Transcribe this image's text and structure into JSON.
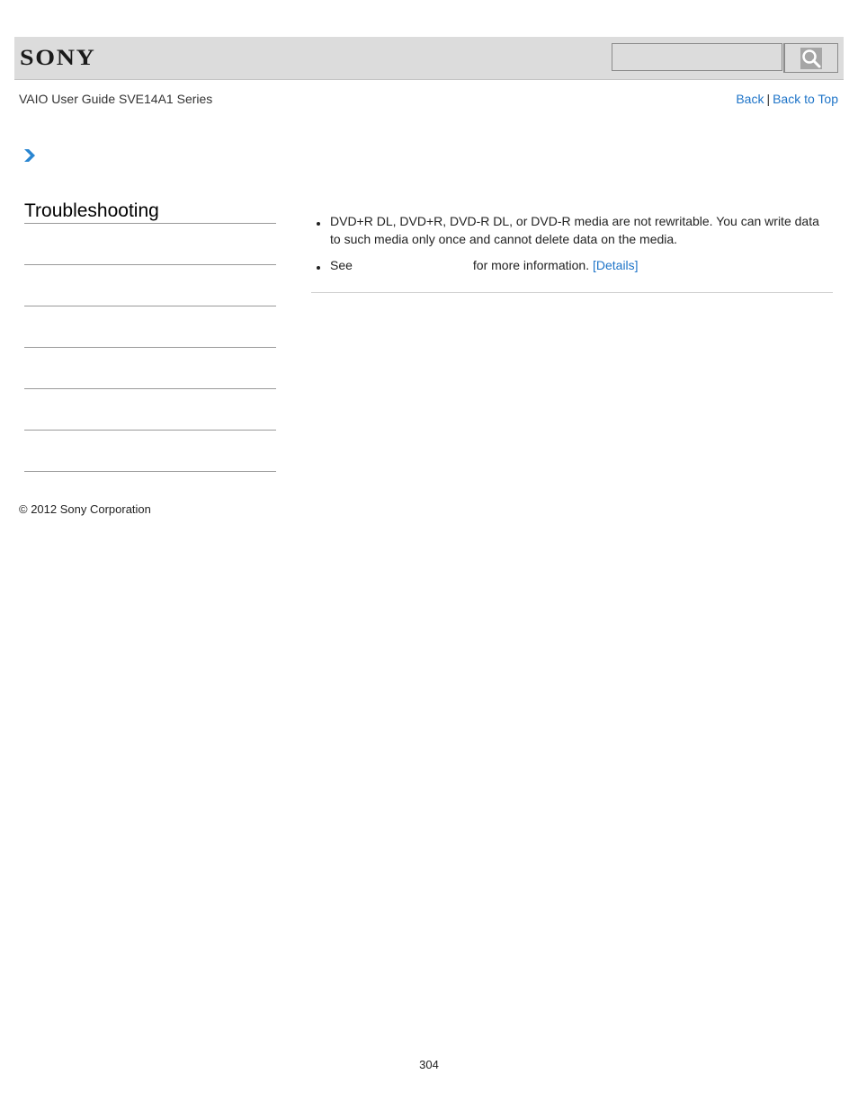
{
  "header": {
    "brand": "SONY",
    "search": {
      "value": "",
      "placeholder": ""
    },
    "search_icon": "magnifier-icon"
  },
  "nav": {
    "guide_title": "VAIO User Guide SVE14A1 Series",
    "back_label": "Back",
    "separator": "|",
    "back_to_top_label": "Back to Top"
  },
  "breadcrumb": {
    "icon": "chevron-right-icon",
    "accent_color": "#2a86d1"
  },
  "sidebar": {
    "title": "Troubleshooting",
    "items": [
      {
        "label": ""
      },
      {
        "label": ""
      },
      {
        "label": ""
      },
      {
        "label": ""
      },
      {
        "label": ""
      },
      {
        "label": ""
      }
    ]
  },
  "content": {
    "bullets": [
      {
        "text": "DVD+R DL, DVD+R, DVD-R DL, or DVD-R media are not rewritable. You can write data to such media only once and cannot delete data on the media."
      },
      {
        "prefix": "See",
        "suffix": "for more information.",
        "link_label": "[Details]"
      }
    ]
  },
  "footer": {
    "copyright": "© 2012 Sony Corporation",
    "page_number": "304"
  },
  "colors": {
    "link": "#1e74c8",
    "header_bg": "#dcdcdc"
  }
}
